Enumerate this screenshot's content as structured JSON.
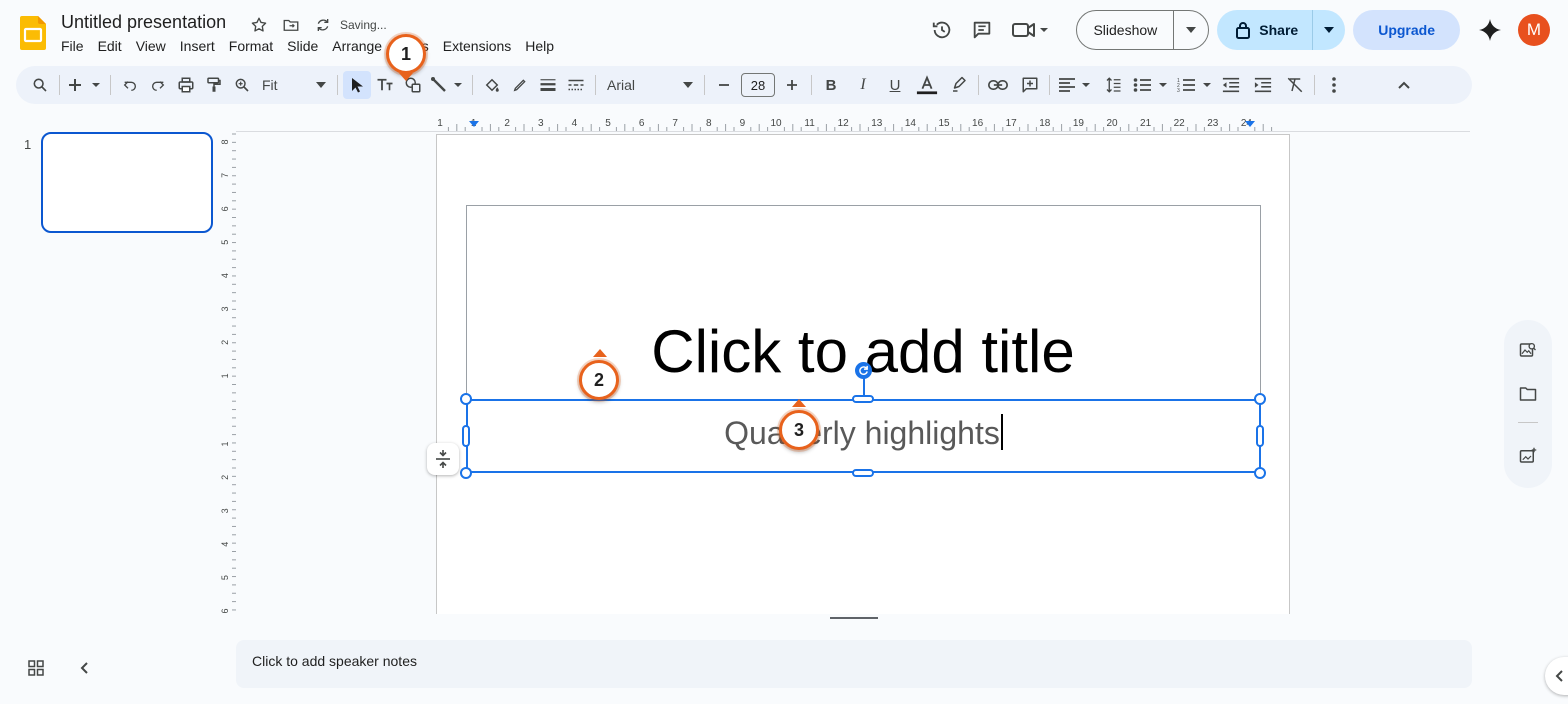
{
  "header": {
    "doc_title": "Untitled presentation",
    "saving_status": "Saving...",
    "menu": [
      "File",
      "Edit",
      "View",
      "Insert",
      "Format",
      "Slide",
      "Arrange",
      "Tools",
      "Extensions",
      "Help"
    ],
    "slideshow_label": "Slideshow",
    "share_label": "Share",
    "upgrade_label": "Upgrade",
    "avatar_initial": "M"
  },
  "toolbar": {
    "zoom_value": "Fit",
    "font_name": "Arial",
    "font_size": "28"
  },
  "filmstrip": {
    "slide_number": "1"
  },
  "slide": {
    "title_placeholder": "Click to add title",
    "subtitle_text": "Quarterly highlights"
  },
  "notes": {
    "placeholder": "Click to add speaker notes"
  },
  "rulers": {
    "horizontal_labels": [
      "1",
      "1",
      "2",
      "3",
      "4",
      "5",
      "6",
      "7",
      "8",
      "9",
      "10",
      "11",
      "12",
      "13",
      "14",
      "15",
      "16",
      "17",
      "18",
      "19",
      "20",
      "21",
      "22",
      "23",
      "24"
    ],
    "vertical_labels_top": [
      "8",
      "7",
      "6",
      "5",
      "4",
      "3",
      "2",
      "1"
    ],
    "vertical_labels_bottom": [
      "1",
      "2",
      "3",
      "4",
      "5",
      "6"
    ]
  },
  "markers": {
    "m1": "1",
    "m2": "2",
    "m3": "3"
  },
  "colors": {
    "accent_blue": "#1a73e8",
    "marker_orange": "#e8621c",
    "share_bg": "#c2e7ff",
    "upgrade_bg": "#d3e3fd",
    "avatar_bg": "#e8501e"
  }
}
